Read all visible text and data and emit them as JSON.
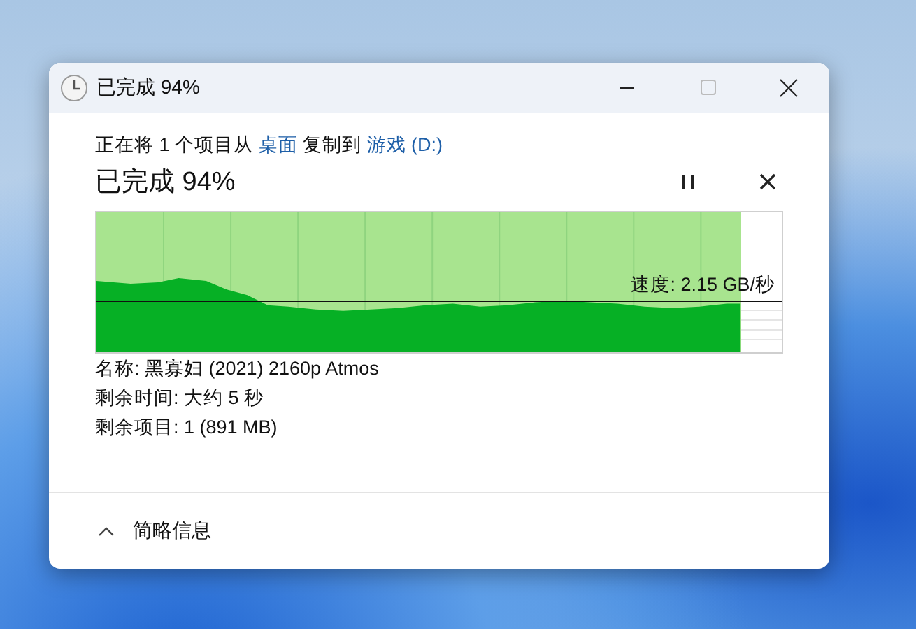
{
  "window": {
    "title": "已完成 94%"
  },
  "header": {
    "text_before": "正在将 1 个项目从 ",
    "source": "桌面",
    "text_middle": " 复制到 ",
    "destination": "游戏 (D:)"
  },
  "progress": {
    "title": "已完成 94%",
    "level": 0.94,
    "speed": "速度: 2.15 GB/秒"
  },
  "details": [
    "名称: 黑寡妇 (2021) 2160p Atmos",
    "剩余时间: 大约 5 秒",
    "剩余项目: 1 (891 MB)"
  ],
  "footer": {
    "toggle": "简略信息",
    "expanded": true
  }
}
